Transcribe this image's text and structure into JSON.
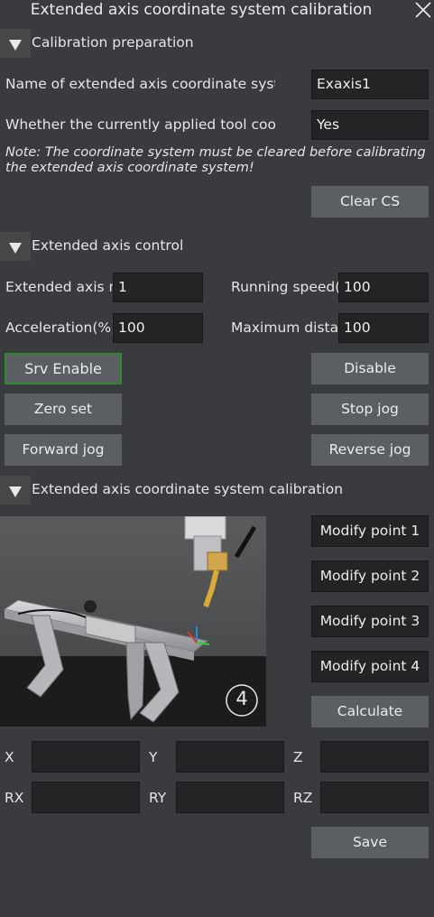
{
  "window": {
    "title": "Extended axis coordinate system calibration"
  },
  "prep": {
    "title": "Calibration preparation",
    "name_label": "Name of extended axis coordinate system",
    "name_value": "Exaxis1",
    "tool_label": "Whether the currently applied tool coordinate system",
    "tool_value": "Yes",
    "note": "Note: The coordinate system must be cleared before calibrating the extended axis coordinate system!",
    "clear_label": "Clear CS"
  },
  "control": {
    "title": "Extended axis control",
    "axis_num_label": "Extended axis number",
    "axis_num_value": "1",
    "speed_label": "Running speed(%)",
    "speed_value": "100",
    "accel_label": "Acceleration(%)",
    "accel_value": "100",
    "maxdist_label": "Maximum distance",
    "maxdist_value": "100",
    "srv_enable": "Srv Enable",
    "disable": "Disable",
    "zero_set": "Zero set",
    "stop_jog": "Stop jog",
    "forward_jog": "Forward jog",
    "reverse_jog": "Reverse jog"
  },
  "calib": {
    "title": "Extended axis coordinate system calibration",
    "step_number": "4",
    "modify1": "Modify point 1",
    "modify2": "Modify point 2",
    "modify3": "Modify point 3",
    "modify4": "Modify point 4",
    "calculate": "Calculate",
    "x_label": "X",
    "y_label": "Y",
    "z_label": "Z",
    "rx_label": "RX",
    "ry_label": "RY",
    "rz_label": "RZ",
    "x_value": "",
    "y_value": "",
    "z_value": "",
    "rx_value": "",
    "ry_value": "",
    "rz_value": "",
    "save": "Save"
  },
  "icons": {
    "close": "close-icon",
    "collapse": "triangle-down-icon"
  },
  "colors": {
    "background": "#393b3e",
    "button": "#5b5e62",
    "field": "#232426",
    "enable_border": "#2f8a2f"
  }
}
